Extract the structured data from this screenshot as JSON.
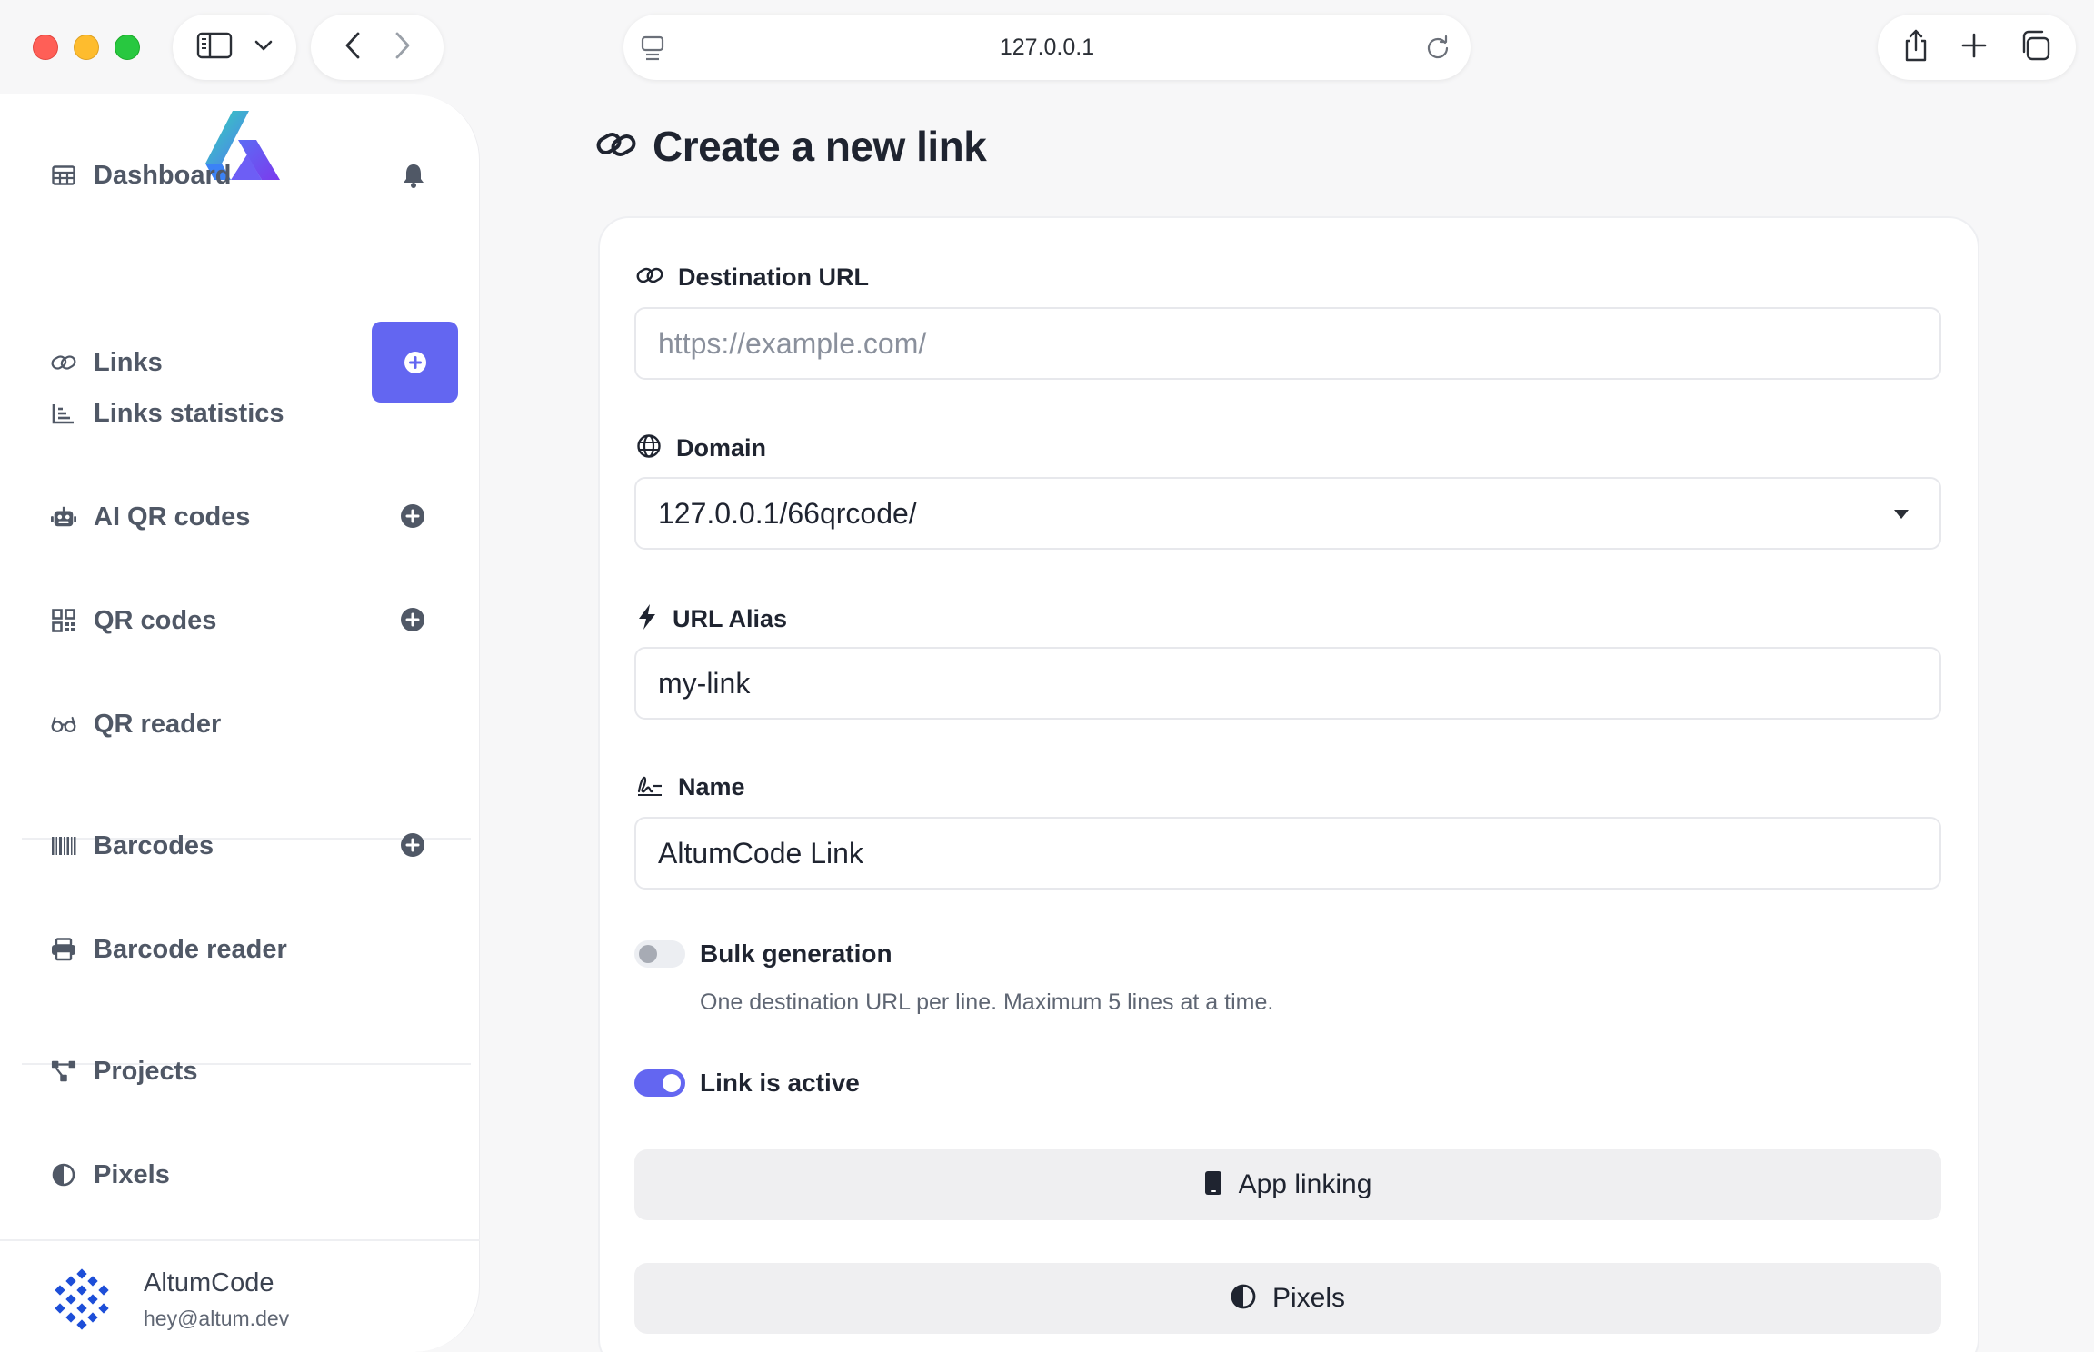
{
  "browser": {
    "url": "127.0.0.1"
  },
  "sidebar": {
    "items": [
      {
        "label": "Dashboard",
        "icon": "table-icon",
        "action_icon": "bell-icon"
      },
      {
        "label": "Links",
        "icon": "link-icon",
        "action_icon": "plus-circle-icon"
      },
      {
        "label": "Links statistics",
        "icon": "chart-icon"
      },
      {
        "label": "AI QR codes",
        "icon": "robot-icon",
        "action_icon": "plus-circle-icon"
      },
      {
        "label": "QR codes",
        "icon": "qrcode-icon",
        "action_icon": "plus-circle-icon"
      },
      {
        "label": "QR reader",
        "icon": "glasses-icon"
      },
      {
        "label": "Barcodes",
        "icon": "barcode-icon",
        "action_icon": "plus-circle-icon"
      },
      {
        "label": "Barcode reader",
        "icon": "print-icon"
      },
      {
        "label": "Projects",
        "icon": "project-diagram-icon"
      },
      {
        "label": "Pixels",
        "icon": "adjust-icon"
      }
    ],
    "user": {
      "name": "AltumCode",
      "email": "hey@altum.dev"
    }
  },
  "main": {
    "title": "Create a new link",
    "fields": {
      "destination_url": {
        "label": "Destination URL",
        "placeholder": "https://example.com/",
        "value": ""
      },
      "domain": {
        "label": "Domain",
        "value": "127.0.0.1/66qrcode/"
      },
      "url_alias": {
        "label": "URL Alias",
        "value": "my-link"
      },
      "name": {
        "label": "Name",
        "value": "AltumCode Link"
      }
    },
    "bulk_generation": {
      "label": "Bulk generation",
      "help": "One destination URL per line. Maximum 5 lines at a time.",
      "enabled": false
    },
    "link_active": {
      "label": "Link is active",
      "enabled": true
    },
    "buttons": {
      "app_linking": "App linking",
      "pixels": "Pixels"
    }
  },
  "colors": {
    "accent": "#6366f1",
    "sidebar_text": "#505866",
    "button_bg": "#efeff1"
  }
}
